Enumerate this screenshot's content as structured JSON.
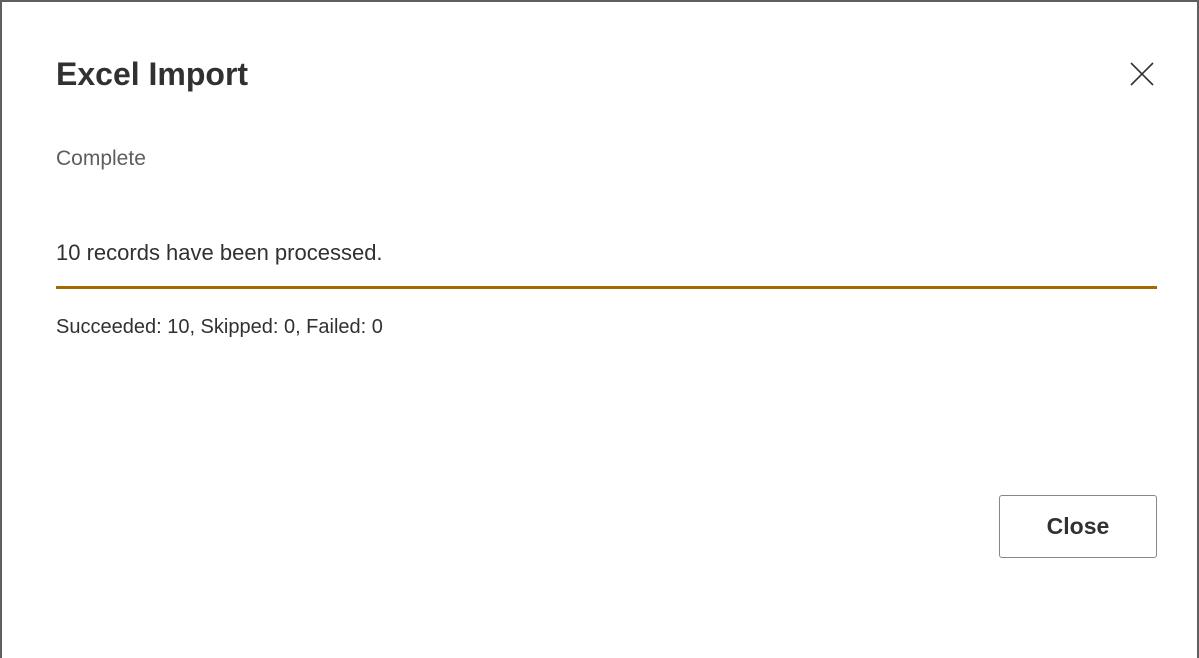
{
  "dialog": {
    "title": "Excel Import",
    "status": "Complete",
    "message": "10 records have been processed.",
    "progress_fraction": 1.0,
    "progress_color": "#a26a00",
    "summary": "Succeeded: 10, Skipped: 0, Failed: 0",
    "close_button_label": "Close",
    "close_icon": "close-icon"
  }
}
